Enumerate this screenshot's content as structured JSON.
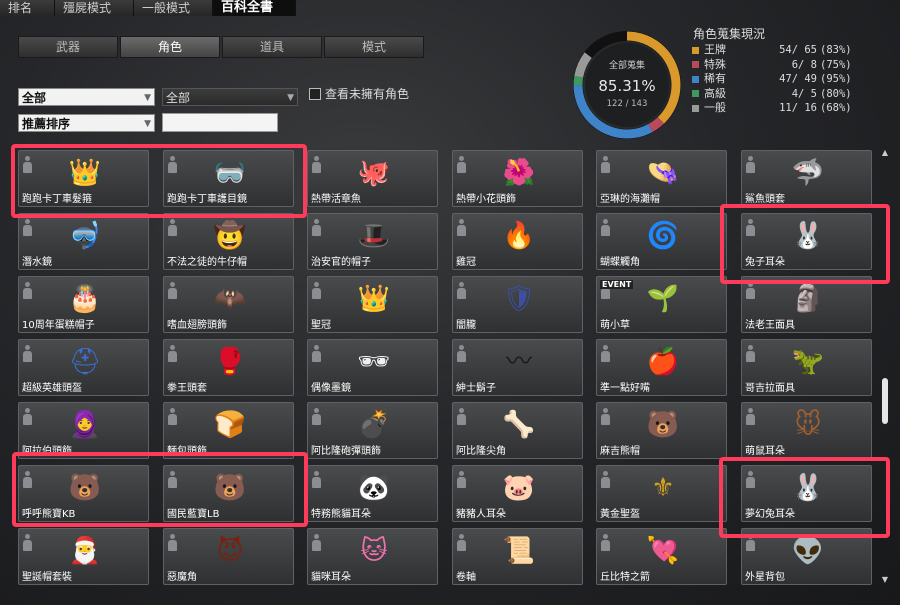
{
  "top_tabs": [
    "排名",
    "殭屍模式",
    "一般模式",
    "百科全書"
  ],
  "sub_tabs": [
    "武器",
    "角色",
    "道具",
    "模式"
  ],
  "filters": {
    "category": "全部",
    "subcategory": "全部",
    "sort": "推薦排序",
    "search_value": "",
    "show_unowned_label": "查看未擁有角色"
  },
  "collection": {
    "title": "角色蒐集現況",
    "donut_label": "全部蒐集",
    "percent": "85.31%",
    "count": "122 / 143",
    "rows": [
      {
        "name": "王牌",
        "count": "54/ 65",
        "pct": "(83%)",
        "color": "#d99a2b"
      },
      {
        "name": "特殊",
        "count": "6/ 8",
        "pct": "(75%)",
        "color": "#b94a5a"
      },
      {
        "name": "稀有",
        "count": "47/ 49",
        "pct": "(95%)",
        "color": "#3f84c9"
      },
      {
        "name": "高級",
        "count": "4/ 5",
        "pct": "(80%)",
        "color": "#3e9a5c"
      },
      {
        "name": "一般",
        "count": "11/ 16",
        "pct": "(68%)",
        "color": "#9a9a9a"
      }
    ]
  },
  "items": [
    {
      "name": "跑跑卡丁車髮箍",
      "icon": "headband-icon",
      "glyph": "👑",
      "color": "#e8d25a"
    },
    {
      "name": "跑跑卡丁車護目鏡",
      "icon": "goggles-icon",
      "glyph": "🥽",
      "color": "#ff7a1a"
    },
    {
      "name": "熱帶活章魚",
      "icon": "octopus-icon",
      "glyph": "🐙",
      "color": "#f08a80"
    },
    {
      "name": "熱帶小花頭飾",
      "icon": "flower-icon",
      "glyph": "🌺",
      "color": "#d65bb5"
    },
    {
      "name": "亞琳的海灘帽",
      "icon": "sun-hat-icon",
      "glyph": "👒",
      "color": "#e2c96a"
    },
    {
      "name": "鯊魚頭套",
      "icon": "shark-icon",
      "glyph": "🦈",
      "color": "#4b86d6"
    },
    {
      "name": "潛水鏡",
      "icon": "diving-mask-icon",
      "glyph": "🤿",
      "color": "#d8d030"
    },
    {
      "name": "不法之徒的牛仔帽",
      "icon": "cowboy-hat-icon",
      "glyph": "🤠",
      "color": "#7a3a2a"
    },
    {
      "name": "治安官的帽子",
      "icon": "sheriff-hat-icon",
      "glyph": "🎩",
      "color": "#cccccc"
    },
    {
      "name": "雞冠",
      "icon": "comb-icon",
      "glyph": "🔥",
      "color": "#d42020"
    },
    {
      "name": "蝴蝶觸角",
      "icon": "antenna-icon",
      "glyph": "🌀",
      "color": "#3a9be0"
    },
    {
      "name": "兔子耳朵",
      "icon": "bunny-ears-icon",
      "glyph": "🐰",
      "color": "#f3c6c6"
    },
    {
      "name": "10周年蛋糕帽子",
      "icon": "cake-hat-icon",
      "glyph": "🎂",
      "color": "#e06060"
    },
    {
      "name": "嗜血翅膀頭飾",
      "icon": "bat-wings-icon",
      "glyph": "🦇",
      "color": "#a02020"
    },
    {
      "name": "聖冠",
      "icon": "crown-icon",
      "glyph": "👑",
      "color": "#9ab0d0"
    },
    {
      "name": "闇朧",
      "icon": "dark-helm-icon",
      "glyph": "🛡",
      "color": "#3c4fa0"
    },
    {
      "name": "萌小草",
      "icon": "sprout-icon",
      "glyph": "🌱",
      "color": "#5ec83a"
    },
    {
      "name": "法老王面具",
      "icon": "pharaoh-mask-icon",
      "glyph": "🗿",
      "color": "#d4a628"
    },
    {
      "name": "超級英雄頭盔",
      "icon": "hero-helmet-icon",
      "glyph": "⛑",
      "color": "#3a6ed0"
    },
    {
      "name": "拳王頭套",
      "icon": "boxing-headgear-icon",
      "glyph": "🥊",
      "color": "#d83030"
    },
    {
      "name": "偶像墨鏡",
      "icon": "heart-glasses-icon",
      "glyph": "🕶",
      "color": "#f0f0f0"
    },
    {
      "name": "紳士鬍子",
      "icon": "mustache-icon",
      "glyph": "〰",
      "color": "#1a1a1a"
    },
    {
      "name": "準一點好嘴",
      "icon": "apple-icon",
      "glyph": "🍎",
      "color": "#e04020"
    },
    {
      "name": "哥吉拉面具",
      "icon": "dino-mask-icon",
      "glyph": "🦖",
      "color": "#b07040"
    },
    {
      "name": "阿拉伯頭飾",
      "icon": "headwrap-icon",
      "glyph": "🧕",
      "color": "#d8b060"
    },
    {
      "name": "麵包頭飾",
      "icon": "bun-icon",
      "glyph": "🍞",
      "color": "#8a5a3a"
    },
    {
      "name": "阿比隆砲彈頭飾",
      "icon": "bomb-headband-icon",
      "glyph": "💣",
      "color": "#333333"
    },
    {
      "name": "阿比隆尖角",
      "icon": "horns-icon",
      "glyph": "🦴",
      "color": "#7a6040"
    },
    {
      "name": "麻吉熊帽",
      "icon": "bear-hat-icon",
      "glyph": "🐻",
      "color": "#f2f2f2"
    },
    {
      "name": "萌鼠耳朵",
      "icon": "mouse-ears-icon",
      "glyph": "🐭",
      "color": "#a06030"
    },
    {
      "name": "呼呼熊寶KB",
      "icon": "red-bear-icon",
      "glyph": "🐻",
      "color": "#e03020"
    },
    {
      "name": "國民藍寶LB",
      "icon": "blue-bear-icon",
      "glyph": "🐻",
      "color": "#3a90e8"
    },
    {
      "name": "特務熊貓耳朵",
      "icon": "panda-ears-icon",
      "glyph": "🐼",
      "color": "#222222"
    },
    {
      "name": "豬豬人耳朵",
      "icon": "pig-ears-icon",
      "glyph": "🐷",
      "color": "#f0a0b0"
    },
    {
      "name": "黃金聖盔",
      "icon": "gold-helmet-icon",
      "glyph": "⚜",
      "color": "#d4a020"
    },
    {
      "name": "夢幻兔耳朵",
      "icon": "dream-bunny-ears-icon",
      "glyph": "🐰",
      "color": "#5a4ac0"
    },
    {
      "name": "聖誕帽套裝",
      "icon": "santa-hat-icon",
      "glyph": "🎅",
      "color": "#d02020"
    },
    {
      "name": "惡魔角",
      "icon": "devil-horns-icon",
      "glyph": "😈",
      "color": "#7a2010"
    },
    {
      "name": "貓咪耳朵",
      "icon": "cat-ears-icon",
      "glyph": "🐱",
      "color": "#f070b0"
    },
    {
      "name": "卷軸",
      "icon": "scroll-icon",
      "glyph": "📜",
      "color": "#bbbbbb"
    },
    {
      "name": "丘比特之箭",
      "icon": "cupid-arrow-icon",
      "glyph": "💘",
      "color": "#d04060"
    },
    {
      "name": "外星背包",
      "icon": "alien-backpack-icon",
      "glyph": "👽",
      "color": "#4a70c0"
    }
  ],
  "badges": {
    "event": "EVENT"
  }
}
